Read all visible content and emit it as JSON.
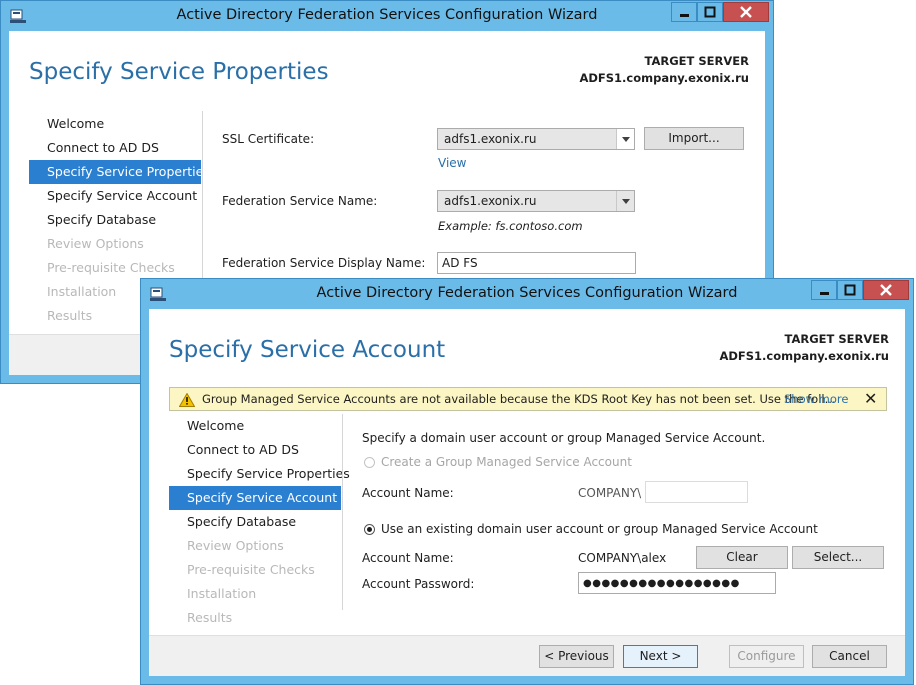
{
  "back_window": {
    "title": "Active Directory Federation Services Configuration Wizard",
    "heading": "Specify Service Properties",
    "target_server_label": "TARGET SERVER",
    "target_server_name": "ADFS1.company.exonix.ru",
    "nav": [
      "Welcome",
      "Connect to AD DS",
      "Specify Service Properties",
      "Specify Service Account",
      "Specify Database",
      "Review Options",
      "Pre-requisite Checks",
      "Installation",
      "Results"
    ],
    "ssl_label": "SSL Certificate:",
    "ssl_value": "adfs1.exonix.ru",
    "import_button": "Import...",
    "view_link": "View",
    "fed_name_label": "Federation Service Name:",
    "fed_name_value": "adfs1.exonix.ru",
    "example_text": "Example: fs.contoso.com",
    "display_name_label": "Federation Service Display Name:",
    "display_name_value": "AD FS"
  },
  "front_window": {
    "title": "Active Directory Federation Services Configuration Wizard",
    "heading": "Specify Service Account",
    "target_server_label": "TARGET SERVER",
    "target_server_name": "ADFS1.company.exonix.ru",
    "warning_text": "Group Managed Service Accounts are not available because the KDS Root Key has not been set. Use the foll...",
    "show_more": "Show more",
    "warning_close": "✕",
    "nav": [
      "Welcome",
      "Connect to AD DS",
      "Specify Service Properties",
      "Specify Service Account",
      "Specify Database",
      "Review Options",
      "Pre-requisite Checks",
      "Installation",
      "Results"
    ],
    "instruction": "Specify a domain user account or group Managed Service Account.",
    "gmsa_option": "Create a Group Managed Service Account",
    "account_name_label_1": "Account Name:",
    "domain_prefix_1": "COMPANY\\",
    "existing_option": "Use an existing domain user account or group Managed Service Account",
    "account_name_label_2": "Account Name:",
    "account_name_value": "COMPANY\\alex",
    "clear_button": "Clear",
    "select_button": "Select...",
    "password_label": "Account Password:",
    "password_value": "●●●●●●●●●●●●●●●●●",
    "previous_button": "< Previous",
    "next_button": "Next >",
    "configure_button": "Configure",
    "cancel_button": "Cancel"
  },
  "colors": {
    "window_frame": "#6bbbe8",
    "accent": "#2b7fd0",
    "heading": "#2a6fa8",
    "close_button": "#c75050",
    "warning_bg": "#fcf6c4"
  },
  "icons": [
    "server-manager-icon",
    "minimize-icon",
    "maximize-icon",
    "close-icon",
    "warning-icon",
    "radio-icon",
    "dropdown-arrow-icon"
  ]
}
